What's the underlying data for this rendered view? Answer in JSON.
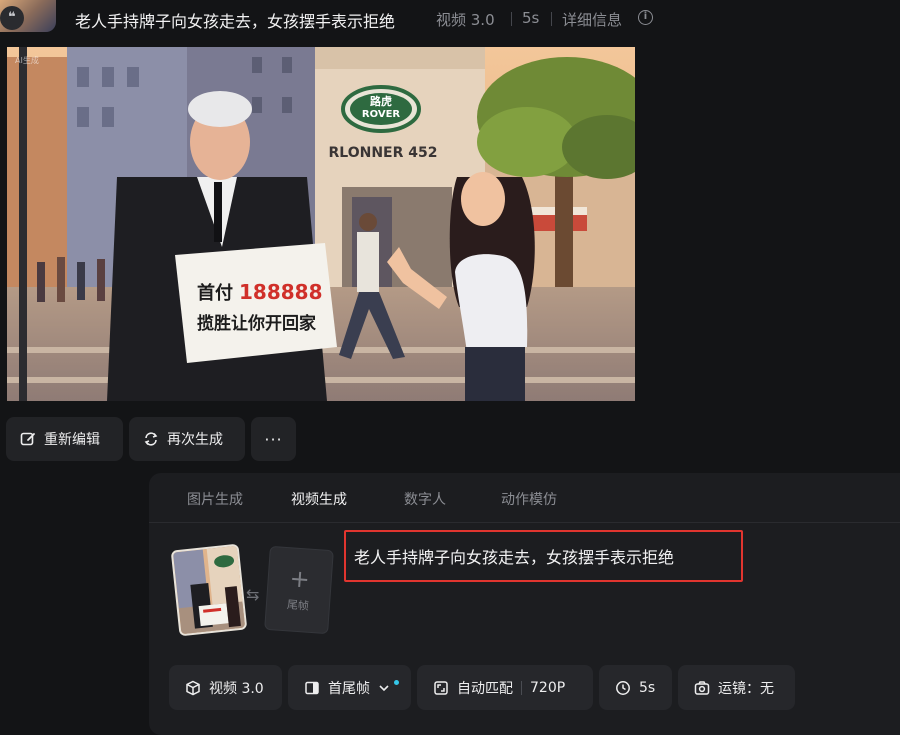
{
  "header": {
    "title": "老人手持牌子向女孩走去，女孩摆手表示拒绝",
    "model": "视频 3.0",
    "duration": "5s",
    "details_link": "详细信息"
  },
  "preview": {
    "watermark": "AI生成",
    "sign_line1_prefix": "首付",
    "sign_line1_number": "188888",
    "sign_line2": "揽胜让你开回家",
    "store_name": "RLONNER 452",
    "logo_top": "路虎",
    "logo_bottom": "ROVER"
  },
  "actions": {
    "re_edit": "重新编辑",
    "regenerate": "再次生成",
    "more": "···"
  },
  "panel": {
    "tabs": [
      "图片生成",
      "视频生成",
      "数字人",
      "动作模仿"
    ],
    "active_tab": 1,
    "tail_frame_label": "尾帧",
    "prompt": "老人手持牌子向女孩走去，女孩摆手表示拒绝",
    "chips": {
      "model": "视频 3.0",
      "frame_mode": "首尾帧",
      "ratio": "自动匹配",
      "resolution": "720P",
      "duration": "5s",
      "camera": "运镜：无"
    }
  },
  "colors": {
    "background": "#131416",
    "panel": "#1c1d20",
    "highlight_border": "#e1352f",
    "indicator_dot": "#35c7e8"
  }
}
